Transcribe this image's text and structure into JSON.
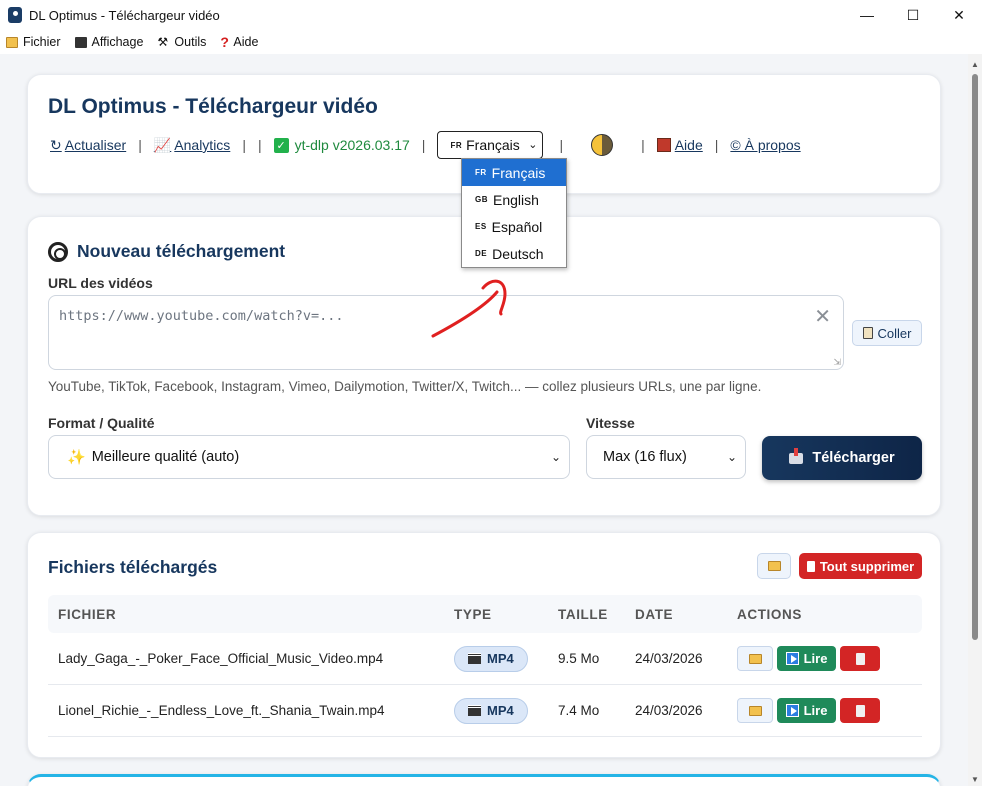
{
  "window": {
    "title": "DL Optimus - Téléchargeur vidéo"
  },
  "menu": {
    "items": [
      "Fichier",
      "Affichage",
      "Outils",
      "Aide"
    ]
  },
  "header": {
    "title": "DL Optimus - Téléchargeur vidéo",
    "refresh": "Actualiser",
    "analytics": "Analytics",
    "version": "yt-dlp v2026.03.17",
    "language": {
      "flag": "FR",
      "selected": "Français"
    },
    "help": "Aide",
    "about": "© À propos"
  },
  "language_dropdown": {
    "options": [
      {
        "flag": "FR",
        "label": "Français"
      },
      {
        "flag": "GB",
        "label": "English"
      },
      {
        "flag": "ES",
        "label": "Español"
      },
      {
        "flag": "DE",
        "label": "Deutsch"
      }
    ]
  },
  "new_download": {
    "title": "Nouveau téléchargement",
    "url_label": "URL des vidéos",
    "url_placeholder": "https://www.youtube.com/watch?v=...",
    "paste_label": "Coller",
    "hint": "YouTube, TikTok, Facebook, Instagram, Vimeo, Dailymotion, Twitter/X, Twitch... — collez plusieurs URLs, une par ligne.",
    "format_label": "Format / Qualité",
    "format_value": "Meilleure qualité (auto)",
    "speed_label": "Vitesse",
    "speed_value": "Max (16 flux)",
    "download_label": "Télécharger"
  },
  "files": {
    "title": "Fichiers téléchargés",
    "delete_all": "Tout supprimer",
    "columns": [
      "FICHIER",
      "TYPE",
      "TAILLE",
      "DATE",
      "ACTIONS"
    ],
    "rows": [
      {
        "name": "Lady_Gaga_-_Poker_Face_Official_Music_Video.mp4",
        "type": "MP4",
        "size": "9.5 Mo",
        "date": "24/03/2026"
      },
      {
        "name": "Lionel_Richie_-_Endless_Love_ft._Shania_Twain.mp4",
        "type": "MP4",
        "size": "7.4 Mo",
        "date": "24/03/2026"
      }
    ],
    "play_label": "Lire"
  },
  "colors": {
    "primary": "#17375e",
    "danger": "#d32525",
    "success": "#1f8a5a",
    "annotation": "#e02020"
  }
}
